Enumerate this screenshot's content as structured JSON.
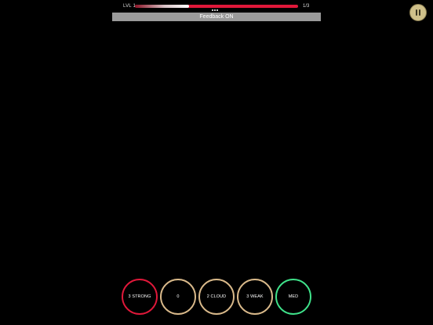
{
  "header": {
    "level_label": "LVL 1",
    "step_label": "1/3",
    "progress_fraction": 0.33,
    "progress_color": "#e0183a",
    "dots_count": 3,
    "feedback_text": "Feedback ON"
  },
  "pause": {
    "icon": "pause-icon",
    "color": "#cfc08a"
  },
  "answers": [
    {
      "label": "3 STRONG",
      "ring_color": "#e0183a"
    },
    {
      "label": "0",
      "ring_color": "#d9b98a"
    },
    {
      "label": "2 CLOUD",
      "ring_color": "#d9b98a"
    },
    {
      "label": "3 WEAK",
      "ring_color": "#d9b98a"
    },
    {
      "label": "MED",
      "ring_color": "#3fe28a"
    }
  ]
}
